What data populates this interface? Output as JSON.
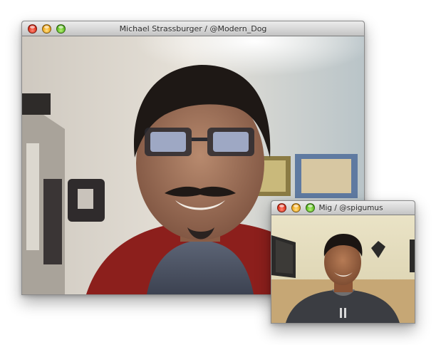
{
  "main_window": {
    "title": "Michael Strassburger / @Modern_Dog",
    "controls": {
      "close_icon": "close-icon",
      "minimize_icon": "minimize-icon",
      "zoom_icon": "zoom-icon"
    }
  },
  "pip_window": {
    "title": "Mig / @spigumus",
    "controls": {
      "close_icon": "close-icon",
      "minimize_icon": "minimize-icon",
      "zoom_icon": "zoom-icon"
    }
  },
  "colors": {
    "close": "#e0341f",
    "minimize": "#efa81a",
    "zoom": "#5fbf22",
    "titlebar": "#d6d6d6"
  }
}
